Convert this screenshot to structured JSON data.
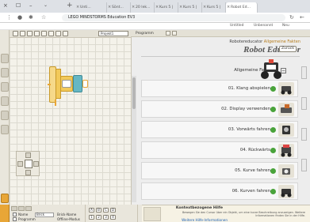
{
  "browser": {
    "window_controls": {
      "close": "×",
      "maximize": "☐",
      "minimize": "–"
    },
    "menu_glyph": "⌄",
    "new_tab_glyph": "+",
    "tabs": [
      {
        "label": "Robot Ed...",
        "active": false
      },
      {
        "label": "Kurs 5 |",
        "active": false
      },
      {
        "label": "Kurs 5 |",
        "active": false
      },
      {
        "label": "Kurs 5 |",
        "active": false
      },
      {
        "label": "20 lek...",
        "active": false
      },
      {
        "label": "Sönt...",
        "active": false
      },
      {
        "label": "Unti...",
        "active": true
      }
    ],
    "address_text": "LEGO MINDSTORMS Education EV3",
    "bookmarks": [
      "Untitled",
      "Unbenannt",
      "Neu"
    ]
  },
  "canvas": {
    "program_tab": "Projekt1",
    "program_dropdown": "Programm"
  },
  "sidebar": {
    "breadcrumb_prefix": "Robotereducator",
    "breadcrumb_link": "Allgemeine Fakten",
    "title": "Robot Educator",
    "back_label": "Zurück",
    "section_label": "Allgemeine Fakten",
    "lessons": [
      {
        "label": "01. Klang abspielen"
      },
      {
        "label": "02. Display verwenden"
      },
      {
        "label": "03. Vorwärts fahren"
      },
      {
        "label": "04. Rückwärts"
      },
      {
        "label": "05. Kurve fahren"
      },
      {
        "label": "06. Kurven fahren"
      }
    ]
  },
  "hardware_panel": {
    "rows": [
      {
        "label": "Name"
      },
      {
        "label": "Brick-Name"
      },
      {
        "label": "Programm"
      },
      {
        "label": "Offline-Modus"
      }
    ],
    "field_value": "Brick"
  },
  "port_panel": {
    "ports": [
      "A",
      "B",
      "C",
      "D",
      "1",
      "2",
      "3",
      "4"
    ]
  },
  "help_panel": {
    "title": "Kontextbezogene Hilfe",
    "body": "Bewegen Sie den Cursor über ein Objekt, um eine kurze Beschreibung anzuzeigen. Weitere Informationen finden Sie in der Hilfe.",
    "link": "Weitere Hilfe-Informationen"
  },
  "colors": {
    "accent_orange": "#e8a637",
    "beam_yellow": "#f2c95a",
    "lesson_dot_green": "#49a33a",
    "canvas_bg": "#f4f2ea"
  }
}
